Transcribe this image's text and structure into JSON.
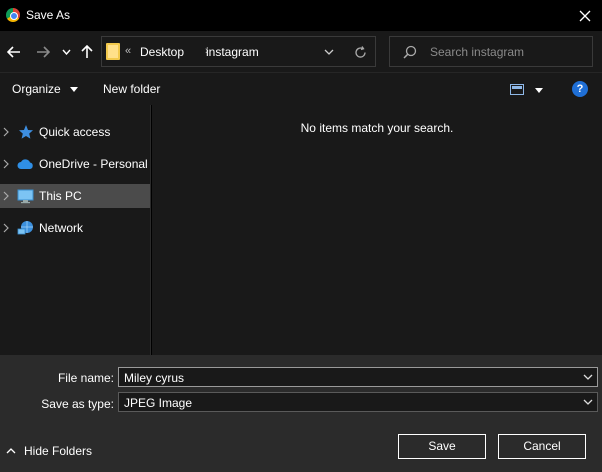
{
  "window": {
    "title": "Save As",
    "app_icon": "chrome-icon"
  },
  "nav": {
    "back_icon": "arrow-left-icon",
    "forward_icon": "arrow-right-icon",
    "recent_icon": "chevron-down-icon",
    "up_icon": "arrow-up-icon"
  },
  "address": {
    "overflow": "«",
    "path": [
      "Desktop",
      "instagram"
    ],
    "refresh_icon": "refresh-icon"
  },
  "search": {
    "placeholder": "Search instagram"
  },
  "toolbar": {
    "organize_label": "Organize",
    "new_folder_label": "New folder",
    "view_icon": "view-icon",
    "help_label": "?"
  },
  "sidebar": {
    "items": [
      {
        "label": "Quick access",
        "icon": "star-icon",
        "selected": false
      },
      {
        "label": "OneDrive - Personal",
        "icon": "cloud-icon",
        "selected": false
      },
      {
        "label": "This PC",
        "icon": "monitor-icon",
        "selected": true
      },
      {
        "label": "Network",
        "icon": "network-icon",
        "selected": false
      }
    ]
  },
  "content": {
    "empty_message": "No items match your search."
  },
  "form": {
    "file_name_label": "File name:",
    "file_name_value": "Miley cyrus",
    "save_type_label": "Save as type:",
    "save_type_value": "JPEG Image"
  },
  "footer": {
    "hide_folders_label": "Hide Folders",
    "save_label": "Save",
    "cancel_label": "Cancel"
  },
  "colors": {
    "accent": "#1f6fd6",
    "folder": "#f2c94c",
    "selected_bg": "#4b4b4b"
  }
}
